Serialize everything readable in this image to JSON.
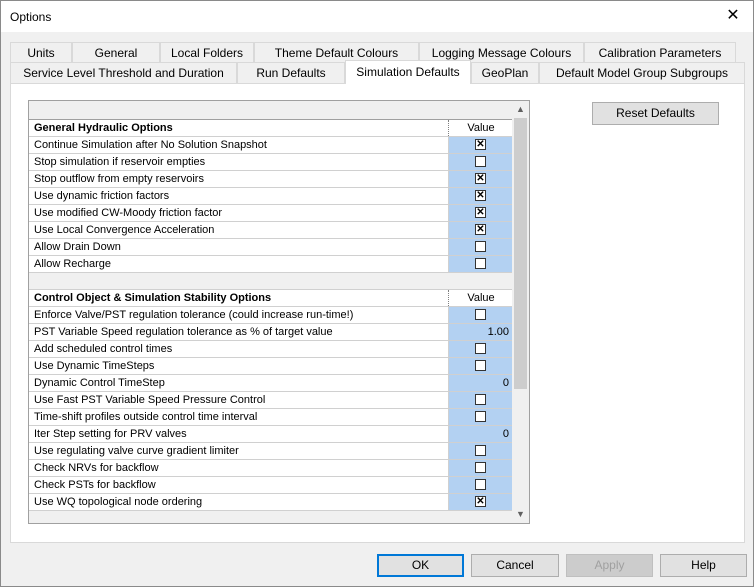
{
  "window": {
    "title": "Options",
    "close_glyph": "✕"
  },
  "tabs_row1": [
    "Units",
    "General",
    "Local Folders",
    "Theme Default Colours",
    "Logging Message Colours",
    "Calibration Parameters"
  ],
  "tabs_row2": [
    "Service Level Threshold and Duration",
    "Run Defaults",
    "Simulation Defaults",
    "GeoPlan",
    "Default Model Group Subgroups"
  ],
  "active_tab": "Simulation Defaults",
  "reset_button": "Reset Defaults",
  "sections": [
    {
      "title": "General Hydraulic Options",
      "value_header": "Value",
      "rows": [
        {
          "label": "Continue Simulation after No Solution Snapshot",
          "type": "check",
          "checked": true
        },
        {
          "label": "Stop simulation if reservoir empties",
          "type": "check",
          "checked": false
        },
        {
          "label": "Stop outflow from empty reservoirs",
          "type": "check",
          "checked": true
        },
        {
          "label": "Use dynamic friction factors",
          "type": "check",
          "checked": true
        },
        {
          "label": "Use modified CW-Moody friction factor",
          "type": "check",
          "checked": true
        },
        {
          "label": "Use Local Convergence Acceleration",
          "type": "check",
          "checked": true
        },
        {
          "label": "Allow Drain Down",
          "type": "check",
          "checked": false
        },
        {
          "label": "Allow Recharge",
          "type": "check",
          "checked": false
        }
      ]
    },
    {
      "title": "Control Object & Simulation Stability Options",
      "value_header": "Value",
      "rows": [
        {
          "label": "Enforce Valve/PST regulation tolerance (could increase run-time!)",
          "type": "check",
          "checked": false
        },
        {
          "label": "PST Variable Speed regulation tolerance as % of target value",
          "type": "number",
          "value": "1.00"
        },
        {
          "label": "Add scheduled control times",
          "type": "check",
          "checked": false
        },
        {
          "label": "Use Dynamic TimeSteps",
          "type": "check",
          "checked": false
        },
        {
          "label": "Dynamic Control TimeStep",
          "type": "number",
          "value": "0"
        },
        {
          "label": "Use Fast PST Variable Speed Pressure Control",
          "type": "check",
          "checked": false
        },
        {
          "label": "Time-shift profiles outside control time interval",
          "type": "check",
          "checked": false
        },
        {
          "label": "Iter Step setting for PRV valves",
          "type": "number",
          "value": "0"
        },
        {
          "label": "Use regulating valve curve gradient limiter",
          "type": "check",
          "checked": false
        },
        {
          "label": "Check NRVs for backflow",
          "type": "check",
          "checked": false
        },
        {
          "label": "Check PSTs for backflow",
          "type": "check",
          "checked": false
        },
        {
          "label": "Use WQ topological node ordering",
          "type": "check",
          "checked": true
        }
      ]
    }
  ],
  "footer": {
    "ok": "OK",
    "cancel": "Cancel",
    "apply": "Apply",
    "help": "Help"
  },
  "colors": {
    "value_cell": "#b3d1f2",
    "primary_border": "#0078d7"
  }
}
